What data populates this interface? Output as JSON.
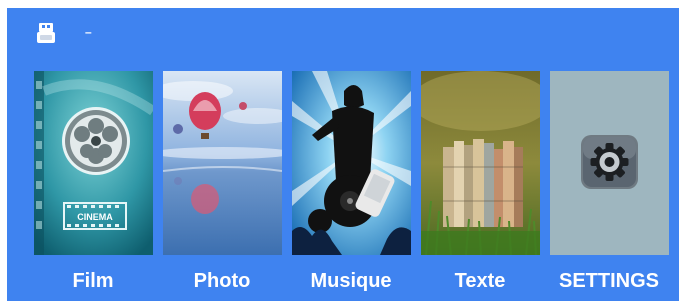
{
  "status_bar": {
    "storage_icon": "usb-drive-icon",
    "storage_status": "–"
  },
  "menu": {
    "items": [
      {
        "label": "Film",
        "icon": "film-reel-icon",
        "badge": "CINEMA"
      },
      {
        "label": "Photo",
        "icon": "hot-air-balloon-icon"
      },
      {
        "label": "Musique",
        "icon": "singer-icon"
      },
      {
        "label": "Texte",
        "icon": "books-icon"
      },
      {
        "label": "SETTINGS",
        "icon": "gear-icon"
      }
    ]
  },
  "colors": {
    "background": "#3f83f0",
    "label_text": "#ffffff"
  }
}
